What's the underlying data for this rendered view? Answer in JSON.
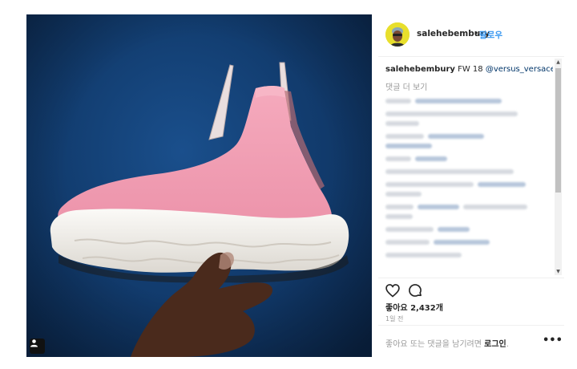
{
  "post": {
    "username": "salehebembury",
    "follow_separator": "•",
    "follow_label": "팔로우",
    "caption_user": "salehebembury",
    "caption_text": "FW 18",
    "caption_mention": "@versus_versace",
    "view_more_comments": "댓글 더 보기",
    "likes": "좋아요 2,432개",
    "time_ago": "1일 전",
    "login_prompt": "좋아요 또는 댓글을 남기려면",
    "login_link": "로그인",
    "login_suffix": ".",
    "more_options": "•••"
  },
  "colors": {
    "accent": "#3897f0",
    "photo_background": "#123d70",
    "shoe_sock": "#f2a2b6",
    "shoe_sole": "#f3f1ed"
  },
  "icons": [
    "user-tag-icon",
    "heart-icon",
    "comment-icon",
    "more-options-icon"
  ]
}
